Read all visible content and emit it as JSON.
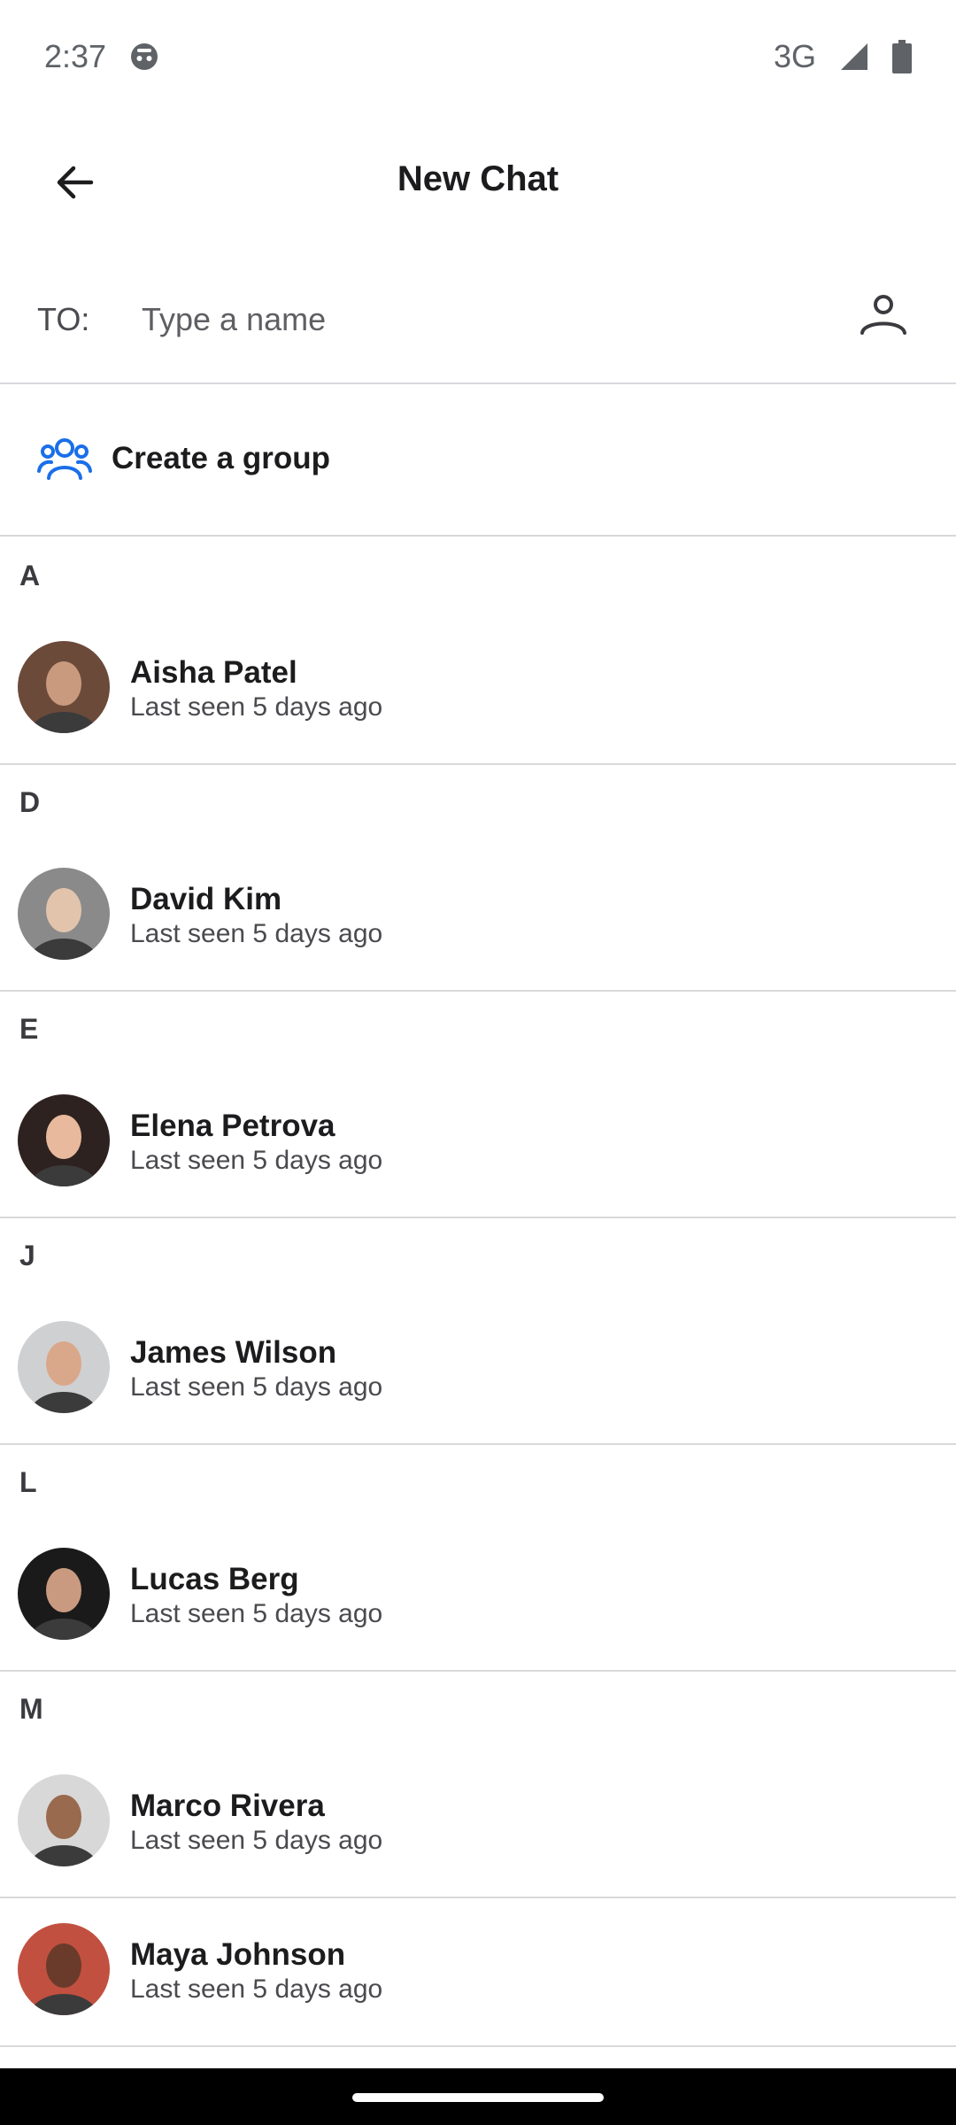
{
  "status_bar": {
    "time": "2:37",
    "network": "3G",
    "icons": [
      "notification-icon",
      "signal-icon",
      "battery-icon"
    ]
  },
  "header": {
    "title": "New Chat",
    "back_icon": "arrow-left-icon"
  },
  "to_field": {
    "label": "TO:",
    "placeholder": "Type a name",
    "value": "",
    "picker_icon": "person-icon"
  },
  "create_group": {
    "label": "Create a group",
    "icon": "group-icon",
    "accent": "#1a6fe8"
  },
  "sections": [
    {
      "letter": "A",
      "contacts": [
        {
          "name": "Aisha Patel",
          "status": "Last seen 5 days ago",
          "avatar_colors": [
            "#6b4a3a",
            "#c99a7e"
          ]
        }
      ]
    },
    {
      "letter": "D",
      "contacts": [
        {
          "name": "David Kim",
          "status": "Last seen 5 days ago",
          "avatar_colors": [
            "#8a8a8a",
            "#e2c4ad"
          ]
        }
      ]
    },
    {
      "letter": "E",
      "contacts": [
        {
          "name": "Elena Petrova",
          "status": "Last seen 5 days ago",
          "avatar_colors": [
            "#2d2220",
            "#e8b99c"
          ]
        }
      ]
    },
    {
      "letter": "J",
      "contacts": [
        {
          "name": "James Wilson",
          "status": "Last seen 5 days ago",
          "avatar_colors": [
            "#cfd0d2",
            "#d9a88a"
          ]
        }
      ]
    },
    {
      "letter": "L",
      "contacts": [
        {
          "name": "Lucas Berg",
          "status": "Last seen 5 days ago",
          "avatar_colors": [
            "#1a1a1a",
            "#c99a80"
          ]
        }
      ]
    },
    {
      "letter": "M",
      "contacts": [
        {
          "name": "Marco Rivera",
          "status": "Last seen 5 days ago",
          "avatar_colors": [
            "#d8d8d8",
            "#9a6a4e"
          ]
        },
        {
          "name": "Maya Johnson",
          "status": "Last seen 5 days ago",
          "avatar_colors": [
            "#c25040",
            "#6a3b2a"
          ]
        }
      ]
    }
  ]
}
